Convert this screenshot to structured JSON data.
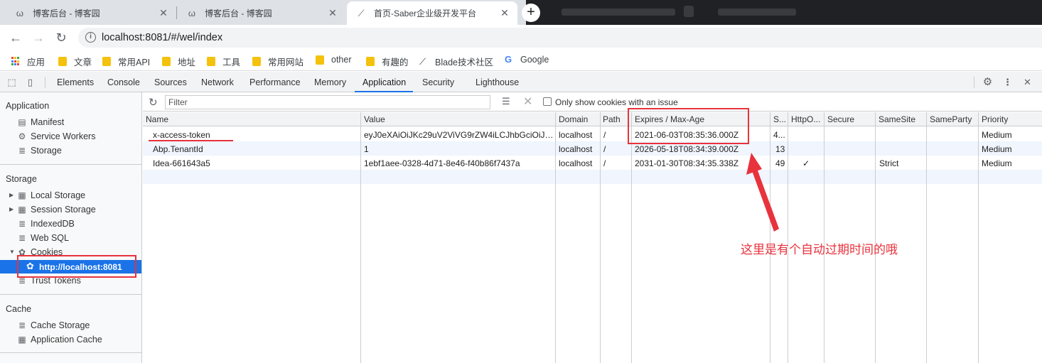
{
  "browser": {
    "tabs": [
      {
        "title": "博客后台 - 博客园",
        "favicon": "cnblogs-icon",
        "active": false
      },
      {
        "title": "博客后台 - 博客园",
        "favicon": "cnblogs-icon",
        "active": false
      },
      {
        "title": "首页-Saber企业级开发平台",
        "favicon": "saber-icon",
        "active": true
      }
    ],
    "new_tab_label": "+",
    "url": "localhost:8081/#/wel/index"
  },
  "bookmarks": [
    {
      "label": "应用",
      "icon": "apps-icon"
    },
    {
      "label": "文章",
      "icon": "folder-icon"
    },
    {
      "label": "常用API",
      "icon": "folder-icon"
    },
    {
      "label": "地址",
      "icon": "folder-icon"
    },
    {
      "label": "工具",
      "icon": "folder-icon"
    },
    {
      "label": "常用网站",
      "icon": "folder-icon"
    },
    {
      "label": "other",
      "icon": "folder-icon"
    },
    {
      "label": "有趣的",
      "icon": "folder-icon"
    },
    {
      "label": "Blade技术社区",
      "icon": "blade-icon"
    },
    {
      "label": "Google",
      "icon": "google-icon"
    }
  ],
  "devtools": {
    "tabs": [
      "Elements",
      "Console",
      "Sources",
      "Network",
      "Performance",
      "Memory",
      "Application",
      "Security",
      "Lighthouse"
    ],
    "active_tab": "Application"
  },
  "sidebar": {
    "application_title": "Application",
    "application_items": [
      "Manifest",
      "Service Workers",
      "Storage"
    ],
    "storage_title": "Storage",
    "storage_items": [
      "Local Storage",
      "Session Storage",
      "IndexedDB",
      "Web SQL",
      "Cookies"
    ],
    "selected_cookie_origin": "http://localhost:8081",
    "trust_tokens": "Trust Tokens",
    "cache_title": "Cache",
    "cache_items": [
      "Cache Storage",
      "Application Cache"
    ]
  },
  "filter": {
    "placeholder": "Filter",
    "only_issues_label": "Only show cookies with an issue"
  },
  "table": {
    "columns": [
      "Name",
      "Value",
      "Domain",
      "Path",
      "Expires / Max-Age",
      "S...",
      "HttpO...",
      "Secure",
      "SameSite",
      "SameParty",
      "Priority"
    ],
    "rows": [
      {
        "name": "x-access-token",
        "value": "eyJ0eXAiOiJKc29uV2ViVG9rZW4iLCJhbGciOiJIUz...",
        "domain": "localhost",
        "path": "/",
        "expires": "2021-06-03T08:35:36.000Z",
        "size": "4...",
        "httponly": "",
        "secure": "",
        "samesite": "",
        "sameparty": "",
        "priority": "Medium"
      },
      {
        "name": "Abp.TenantId",
        "value": "1",
        "domain": "localhost",
        "path": "/",
        "expires": "2026-05-18T08:34:39.000Z",
        "size": "13",
        "httponly": "",
        "secure": "",
        "samesite": "",
        "sameparty": "",
        "priority": "Medium"
      },
      {
        "name": "Idea-661643a5",
        "value": "1ebf1aee-0328-4d71-8e46-f40b86f7437a",
        "domain": "localhost",
        "path": "/",
        "expires": "2031-01-30T08:34:35.338Z",
        "size": "49",
        "httponly": "✓",
        "secure": "",
        "samesite": "Strict",
        "sameparty": "",
        "priority": "Medium"
      }
    ]
  },
  "annotation": {
    "text": "这里是有个自动过期时间的哦",
    "color": "#e8323c"
  },
  "colors": {
    "accent": "#1a73e8",
    "selected_row": "#1a73e8",
    "annotation_red": "#e8323c"
  }
}
